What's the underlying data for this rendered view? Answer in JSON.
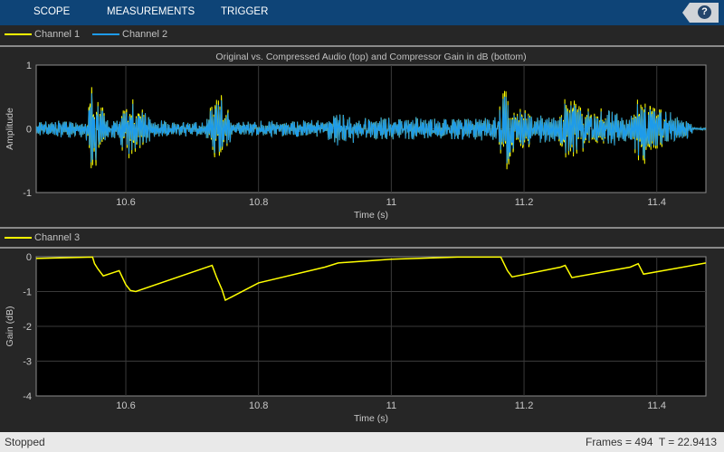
{
  "toolbar": {
    "tabs": [
      "SCOPE",
      "MEASUREMENTS",
      "TRIGGER"
    ],
    "help": "?"
  },
  "legend1": [
    {
      "label": "Channel 1",
      "color": "#ffff00"
    },
    {
      "label": "Channel 2",
      "color": "#1e9bea"
    }
  ],
  "legend2": [
    {
      "label": "Channel 3",
      "color": "#ffff00"
    }
  ],
  "status": {
    "state": "Stopped",
    "frames": "Frames = 494",
    "time": "T = 22.9413"
  },
  "chart_data": [
    {
      "type": "line",
      "title": "Original vs. Compressed Audio (top) and Compressor Gain in dB (bottom)",
      "xlabel": "Time (s)",
      "ylabel": "Amplitude",
      "xlim": [
        10.465,
        11.474
      ],
      "ylim": [
        -1,
        1
      ],
      "xticks": [
        "10.6",
        "10.8",
        "11",
        "11.2",
        "11.4"
      ],
      "xtick_values": [
        10.6,
        10.8,
        11,
        11.2,
        11.4
      ],
      "yticks": [
        "1",
        "0",
        "-1"
      ],
      "ytick_values": [
        1,
        0,
        -1
      ],
      "grid": true,
      "series": [
        {
          "name": "Channel 1",
          "color": "#ffff00"
        },
        {
          "name": "Channel 2",
          "color": "#1e9bea"
        }
      ],
      "envelope": [
        [
          10.465,
          0.12
        ],
        [
          10.54,
          0.15
        ],
        [
          10.548,
          0.75
        ],
        [
          10.56,
          0.5
        ],
        [
          10.575,
          0.15
        ],
        [
          10.59,
          0.15
        ],
        [
          10.6,
          0.65
        ],
        [
          10.62,
          0.4
        ],
        [
          10.64,
          0.15
        ],
        [
          10.72,
          0.12
        ],
        [
          10.735,
          0.6
        ],
        [
          10.745,
          0.6
        ],
        [
          10.76,
          0.12
        ],
        [
          10.9,
          0.15
        ],
        [
          10.92,
          0.3
        ],
        [
          10.95,
          0.2
        ],
        [
          11.1,
          0.18
        ],
        [
          11.16,
          0.2
        ],
        [
          11.17,
          0.8
        ],
        [
          11.19,
          0.35
        ],
        [
          11.25,
          0.2
        ],
        [
          11.265,
          0.75
        ],
        [
          11.29,
          0.4
        ],
        [
          11.36,
          0.2
        ],
        [
          11.375,
          0.65
        ],
        [
          11.4,
          0.35
        ],
        [
          11.45,
          0.15
        ],
        [
          11.455,
          0.02
        ],
        [
          11.474,
          0.02
        ]
      ]
    },
    {
      "type": "line",
      "xlabel": "Time (s)",
      "ylabel": "Gain (dB)",
      "xlim": [
        10.465,
        11.474
      ],
      "ylim": [
        -4,
        0
      ],
      "xticks": [
        "10.6",
        "10.8",
        "11",
        "11.2",
        "11.4"
      ],
      "xtick_values": [
        10.6,
        10.8,
        11,
        11.2,
        11.4
      ],
      "yticks": [
        "0",
        "-1",
        "-2",
        "-3",
        "-4"
      ],
      "ytick_values": [
        0,
        -1,
        -2,
        -3,
        -4
      ],
      "grid": true,
      "series": [
        {
          "name": "Channel 3",
          "color": "#ffff00",
          "x": [
            10.465,
            10.55,
            10.553,
            10.558,
            10.566,
            10.59,
            10.6,
            10.607,
            10.615,
            10.73,
            10.737,
            10.745,
            10.75,
            10.8,
            10.9,
            10.92,
            11.0,
            11.1,
            11.165,
            11.175,
            11.182,
            11.255,
            11.262,
            11.272,
            11.36,
            11.372,
            11.38,
            11.474
          ],
          "y": [
            -0.05,
            -0.01,
            -0.2,
            -0.35,
            -0.55,
            -0.4,
            -0.8,
            -0.97,
            -1.0,
            -0.25,
            -0.6,
            -0.95,
            -1.25,
            -0.75,
            -0.3,
            -0.18,
            -0.07,
            -0.01,
            -0.01,
            -0.4,
            -0.58,
            -0.3,
            -0.25,
            -0.6,
            -0.3,
            -0.2,
            -0.5,
            -0.18
          ]
        }
      ]
    }
  ]
}
